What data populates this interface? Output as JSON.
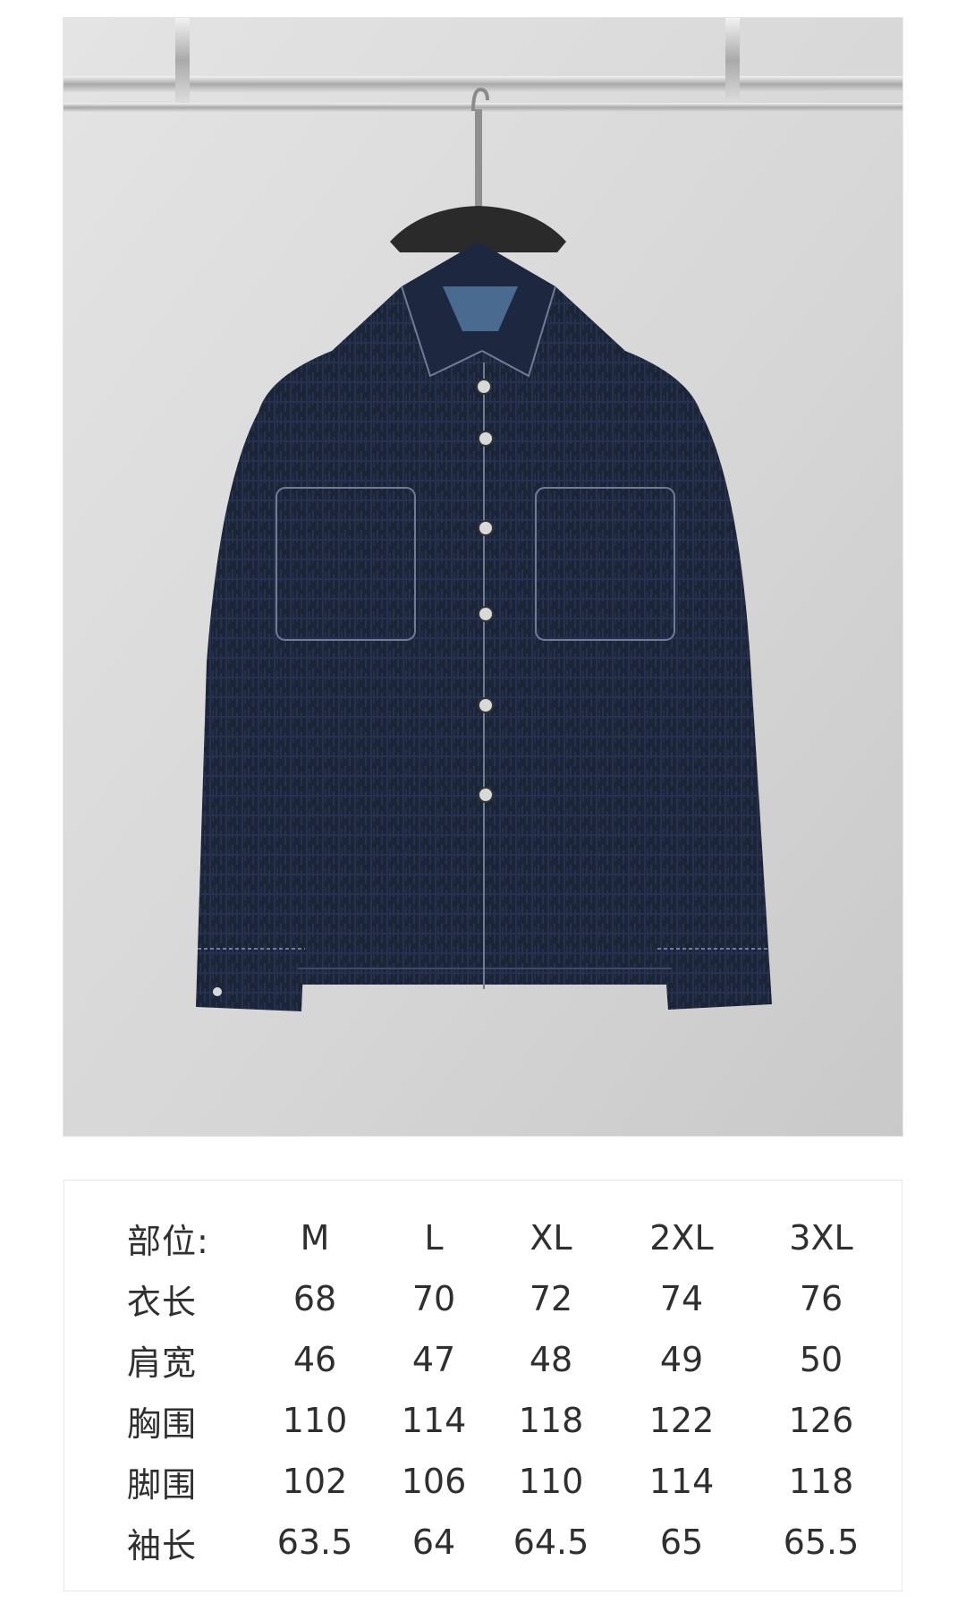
{
  "product_photo": {
    "subject": "denim shirt jacket on hanger",
    "colors": {
      "backdrop": "#d8d8d8",
      "rail": "#c9c9c9",
      "jacket": "#1c2438",
      "stitching": "#6f7c95",
      "hanger": "#2a2a2a"
    }
  },
  "size_chart": {
    "header": {
      "label": "部位:",
      "sizes": [
        "M",
        "L",
        "XL",
        "2XL",
        "3XL"
      ]
    },
    "rows": [
      {
        "label": "衣长",
        "values": [
          "68",
          "70",
          "72",
          "74",
          "76"
        ]
      },
      {
        "label": "肩宽",
        "values": [
          "46",
          "47",
          "48",
          "49",
          "50"
        ]
      },
      {
        "label": "胸围",
        "values": [
          "110",
          "114",
          "118",
          "122",
          "126"
        ]
      },
      {
        "label": "脚围",
        "values": [
          "102",
          "106",
          "110",
          "114",
          "118"
        ]
      },
      {
        "label": "袖长",
        "values": [
          "63.5",
          "64",
          "64.5",
          "65",
          "65.5"
        ]
      }
    ]
  }
}
